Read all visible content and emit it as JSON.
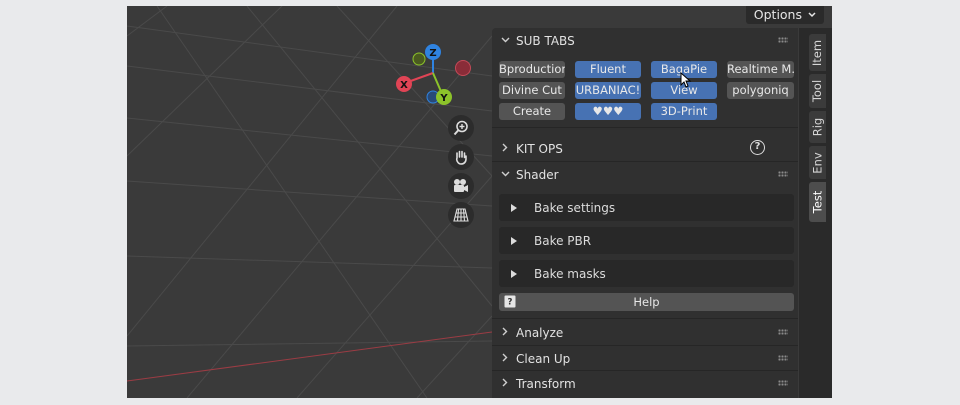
{
  "header": {
    "options_label": "Options"
  },
  "gizmo": {
    "z": "Z",
    "x": "X",
    "y": "Y"
  },
  "nav_icons": [
    "zoom-icon",
    "hand-icon",
    "camera-icon",
    "grid-icon"
  ],
  "subtabs": {
    "title": "SUB TABS",
    "buttons": [
      {
        "label": "Bproduction",
        "style": "grey"
      },
      {
        "label": "Fluent",
        "style": "blue"
      },
      {
        "label": "BagaPie",
        "style": "blue"
      },
      {
        "label": "Realtime M...",
        "style": "grey"
      },
      {
        "label": "Divine Cut",
        "style": "grey"
      },
      {
        "label": "URBANIAC!",
        "style": "blue"
      },
      {
        "label": "View",
        "style": "blue"
      },
      {
        "label": "polygoniq",
        "style": "grey"
      },
      {
        "label": "Create",
        "style": "grey"
      },
      {
        "label": "♥♥♥",
        "style": "blue"
      },
      {
        "label": "3D-Print",
        "style": "blue"
      }
    ]
  },
  "kitops": {
    "title": "KIT OPS",
    "help_glyph": "?"
  },
  "shader": {
    "title": "Shader",
    "rows": [
      "Bake settings",
      "Bake PBR",
      "Bake masks"
    ],
    "help_label": "Help"
  },
  "sections": [
    "Analyze",
    "Clean Up",
    "Transform"
  ],
  "tabs": [
    "Item",
    "Tool",
    "Rig",
    "Env",
    "Test"
  ],
  "active_tab": "Test",
  "colors": {
    "accent_blue": "#4772b3",
    "gizmo_z": "#2f83e0",
    "gizmo_x": "#e04455",
    "gizmo_y": "#8cc32a"
  }
}
